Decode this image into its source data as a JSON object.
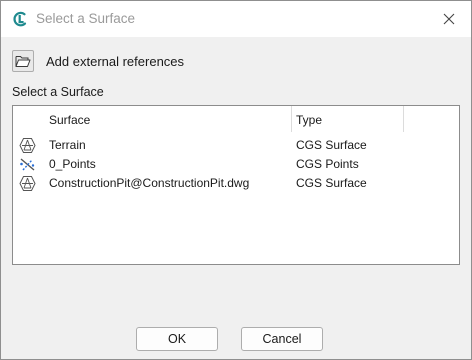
{
  "window": {
    "title": "Select a Surface",
    "app_icon": "civil-app-icon",
    "close_icon": "close-icon"
  },
  "toolbar": {
    "add_references_label": "Add external references",
    "add_references_icon": "folder-open-icon"
  },
  "section_label": "Select a Surface",
  "table": {
    "columns": [
      "Surface",
      "Type"
    ],
    "rows": [
      {
        "name": "Terrain",
        "type": "CGS Surface",
        "icon": "surface-icon"
      },
      {
        "name": "0_Points",
        "type": "CGS Points",
        "icon": "points-icon"
      },
      {
        "name": "ConstructionPit@ConstructionPit.dwg",
        "type": "CGS Surface",
        "icon": "surface-icon"
      }
    ]
  },
  "buttons": {
    "ok": "OK",
    "cancel": "Cancel"
  },
  "colors": {
    "dialog_bg": "#f0f0f0",
    "title_text": "#9a9a9a",
    "app_icon_teal": "#1f8a8f",
    "points_icon_blue": "#2a6fd6"
  }
}
